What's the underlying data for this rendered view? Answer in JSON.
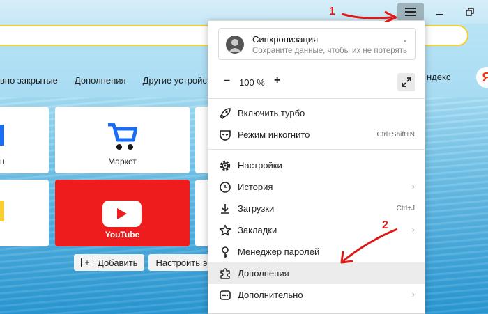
{
  "browser": {
    "bookmarks": [
      "вно закрытые",
      "Дополнения",
      "Другие устройст"
    ],
    "right_text": "ндекс",
    "logo_letter": "Я"
  },
  "tiles": {
    "left_partial_label": "н",
    "market_label": "Маркет",
    "youtube_label": "YouTube",
    "add_label": "Добавить",
    "customize_label": "Настроить э"
  },
  "menu": {
    "sync": {
      "title": "Синхронизация",
      "subtitle": "Сохраните данные, чтобы их не потерять"
    },
    "zoom": {
      "minus": "−",
      "value": "100 %",
      "plus": "+"
    },
    "items": [
      {
        "label": "Включить турбо",
        "icon": "rocket-icon",
        "shortcut": ""
      },
      {
        "label": "Режим инкогнито",
        "icon": "mask-icon",
        "shortcut": "Ctrl+Shift+N"
      },
      {
        "label": "Настройки",
        "icon": "gear-icon",
        "shortcut": ""
      },
      {
        "label": "История",
        "icon": "clock-icon",
        "shortcut": ""
      },
      {
        "label": "Загрузки",
        "icon": "download-icon",
        "shortcut": "Ctrl+J"
      },
      {
        "label": "Закладки",
        "icon": "star-icon",
        "shortcut": ""
      },
      {
        "label": "Менеджер паролей",
        "icon": "key-icon",
        "shortcut": ""
      },
      {
        "label": "Дополнения",
        "icon": "puzzle-icon",
        "shortcut": ""
      },
      {
        "label": "Дополнительно",
        "icon": "more-icon",
        "shortcut": ""
      }
    ]
  },
  "annotations": {
    "step1": "1",
    "step2": "2",
    "color": "#e01818"
  },
  "colors": {
    "omnibox_border": "#f8cf2e",
    "youtube_red": "#ee1c1c",
    "market_blue": "#1a6ef5"
  }
}
